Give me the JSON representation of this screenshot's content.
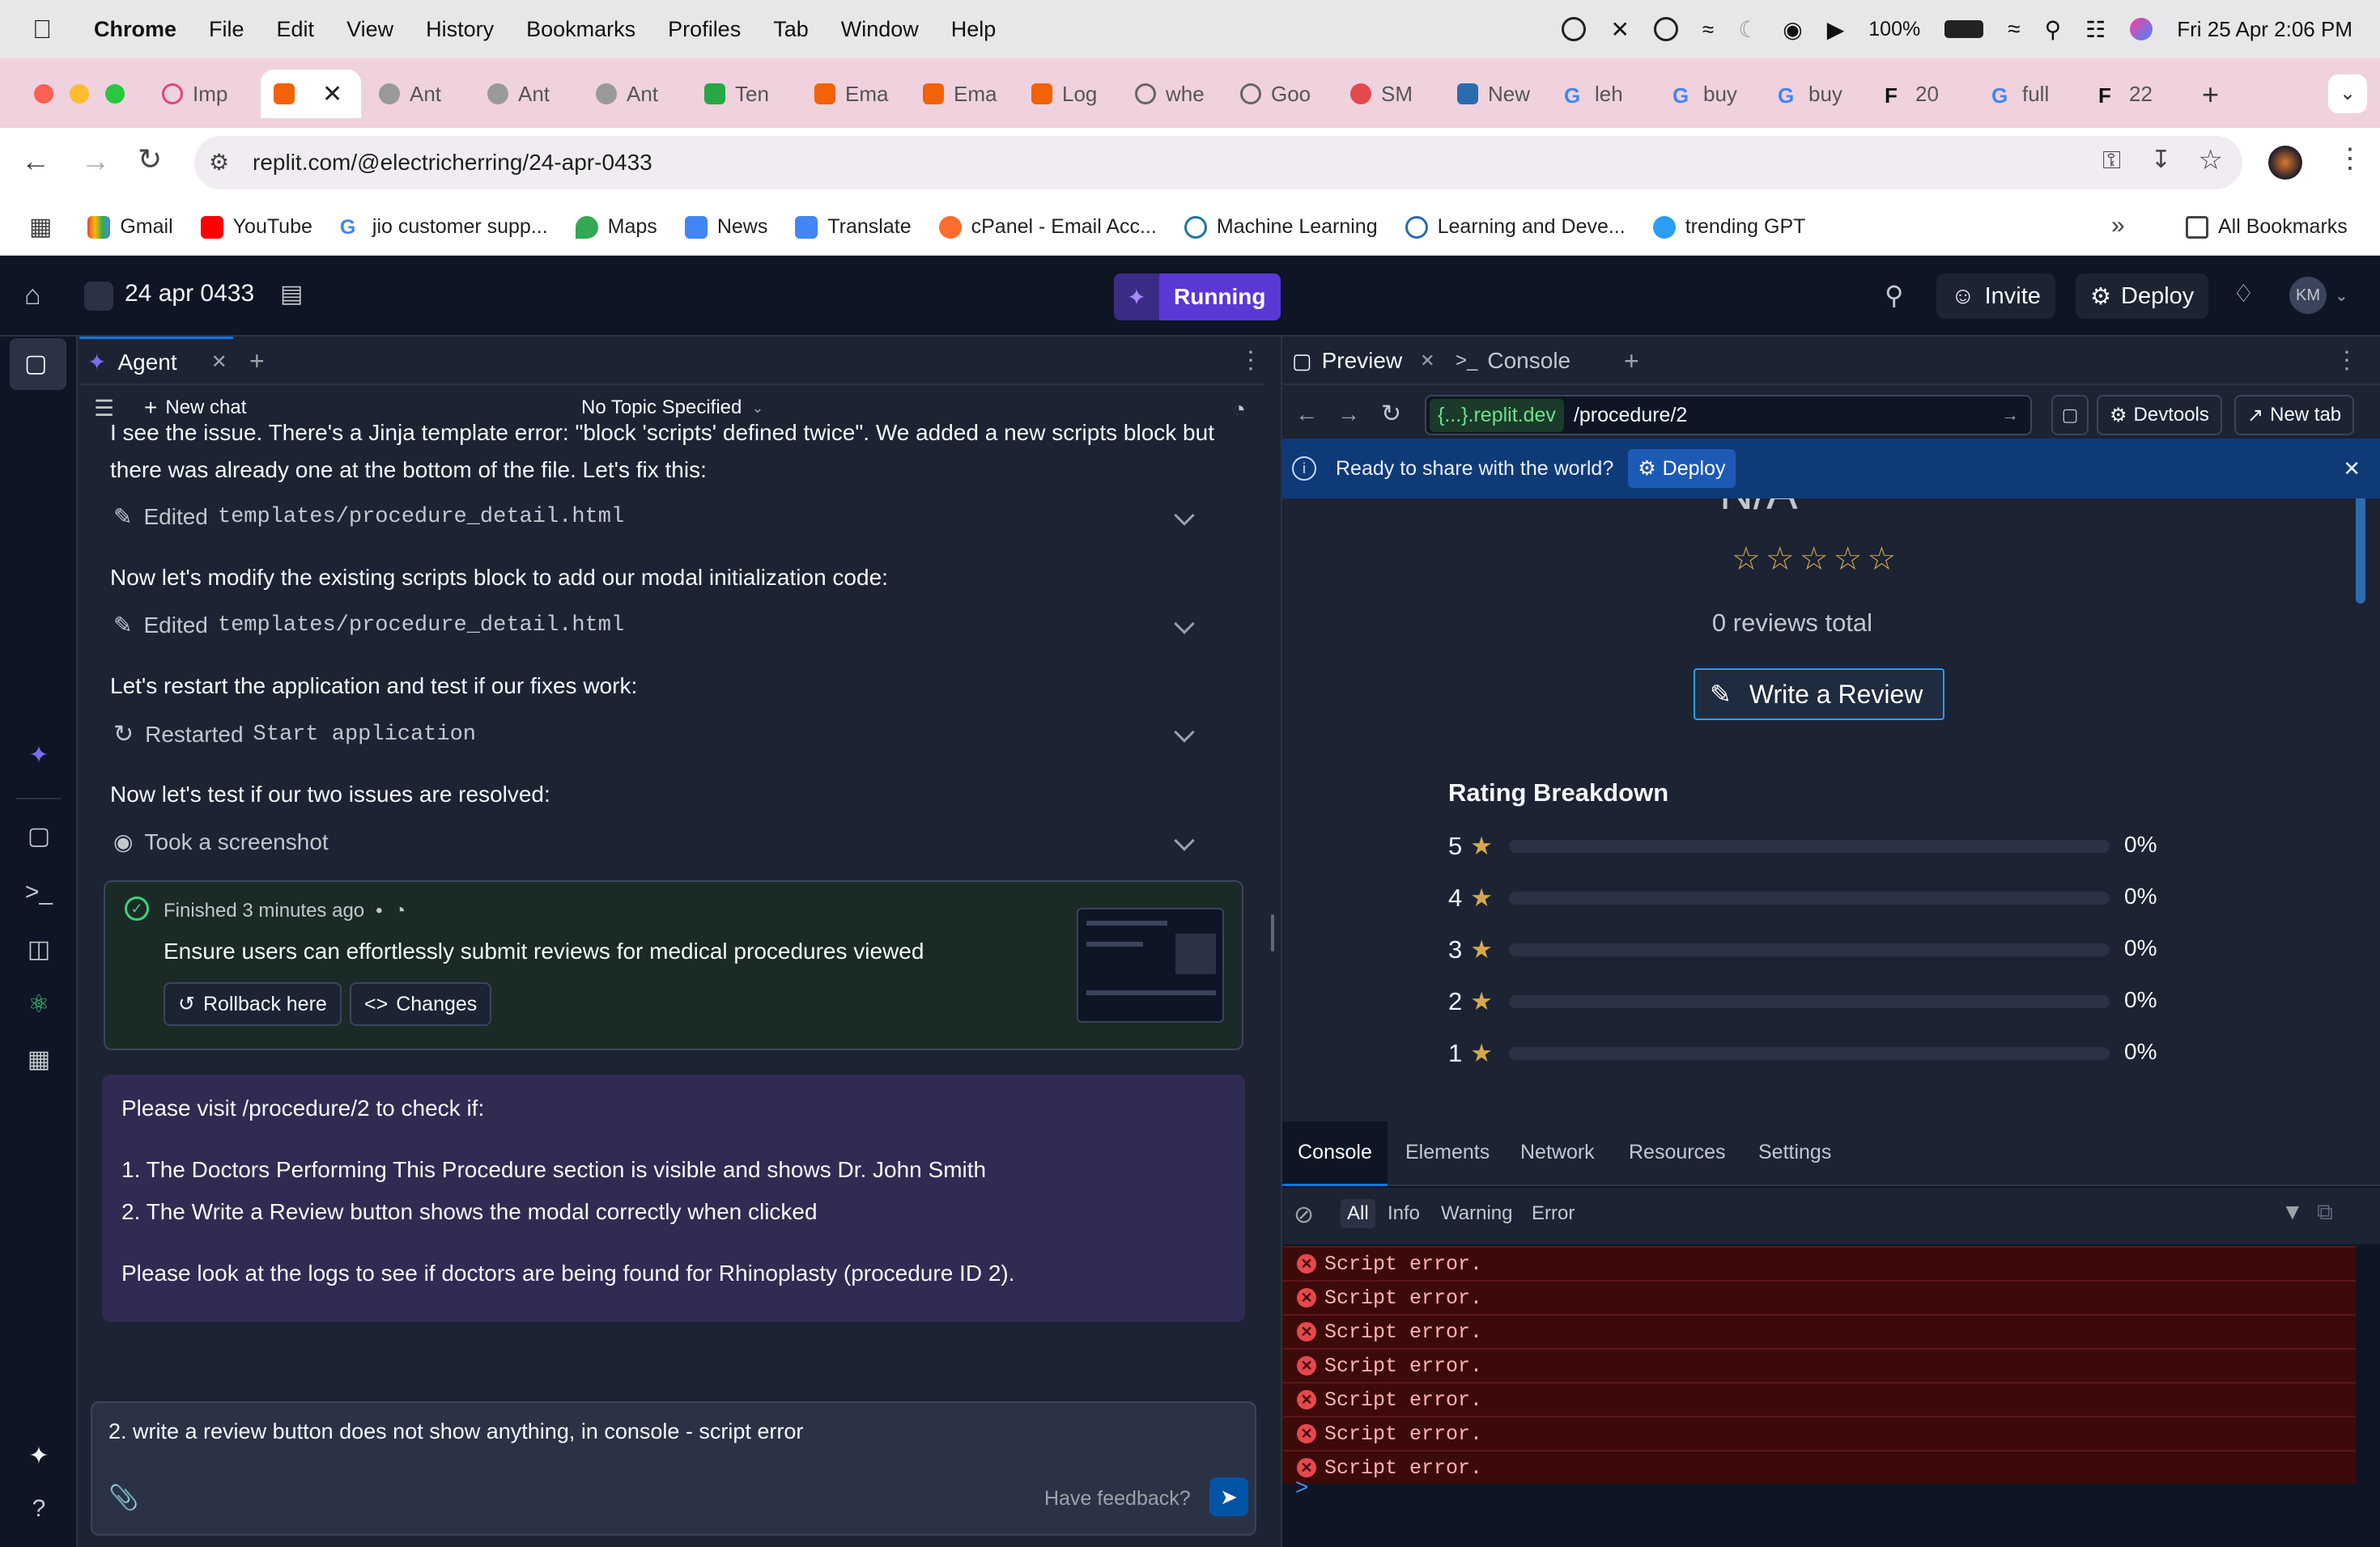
{
  "menubar": {
    "app": "Chrome",
    "items": [
      "File",
      "Edit",
      "View",
      "History",
      "Bookmarks",
      "Profiles",
      "Tab",
      "Window",
      "Help"
    ],
    "battery": "100%",
    "datetime": "Fri 25 Apr  2:06 PM"
  },
  "tabs": [
    {
      "label": "Imp"
    },
    {
      "label": ""
    },
    {
      "label": "Ant"
    },
    {
      "label": "Ant"
    },
    {
      "label": "Ant"
    },
    {
      "label": "Ten"
    },
    {
      "label": "Ema"
    },
    {
      "label": "Ema"
    },
    {
      "label": "Log"
    },
    {
      "label": "whe"
    },
    {
      "label": "Goo"
    },
    {
      "label": "SM"
    },
    {
      "label": "New"
    },
    {
      "label": "leh"
    },
    {
      "label": "buy"
    },
    {
      "label": "buy"
    },
    {
      "label": "20"
    },
    {
      "label": "full"
    },
    {
      "label": "22"
    }
  ],
  "address": {
    "url": "replit.com/@electricherring/24-apr-0433"
  },
  "bookmarks": [
    "Gmail",
    "YouTube",
    "jio customer supp...",
    "Maps",
    "News",
    "Translate",
    "cPanel - Email Acc...",
    "Machine Learning",
    "Learning and Deve...",
    "trending GPT"
  ],
  "bookmarks_all": "All Bookmarks",
  "replit": {
    "project": "24 apr 0433",
    "running": "Running",
    "invite": "Invite",
    "deploy": "Deploy",
    "avatar": "KM"
  },
  "agent": {
    "tab": "Agent",
    "new_chat": "New chat",
    "topic": "No Topic Specified",
    "msg1_line1": "I see the issue. There's a Jinja template error: \"block 'scripts' defined twice\". We added a new scripts block but",
    "msg1_line2": "there was already one at the bottom of the file. Let's fix this:",
    "action1_prefix": "Edited",
    "action1_file": "templates/procedure_detail.html",
    "msg2": "Now let's modify the existing scripts block to add our modal initialization code:",
    "action2_prefix": "Edited",
    "action2_file": "templates/procedure_detail.html",
    "msg3": "Let's restart the application and test if our fixes work:",
    "action3_prefix": "Restarted",
    "action3_file": "Start application",
    "msg4": "Now let's test if our two issues are resolved:",
    "action4": "Took a screenshot",
    "finished": "Finished 3 minutes ago",
    "checkpoint_title": "Ensure users can effortlessly submit reviews for medical procedures viewed",
    "rollback": "Rollback here",
    "changes": "Changes",
    "user_msg_intro": "Please visit /procedure/2 to check if:",
    "user_item1": "1. The Doctors Performing This Procedure section is visible and shows Dr. John Smith",
    "user_item2": "2. The Write a Review button shows the modal correctly when clicked",
    "user_msg_outro": "Please look at the logs to see if doctors are being found for Rhinoplasty (procedure ID 2).",
    "input_value": "2. write a review button does not show anything, in console - script error",
    "feedback": "Have feedback?"
  },
  "preview": {
    "tab_preview": "Preview",
    "tab_console": "Console",
    "domain": "{...}.replit.dev",
    "path": "/procedure/2",
    "devtools": "Devtools",
    "new_tab": "New tab",
    "banner_text": "Ready to share with the world?",
    "banner_deploy": "Deploy",
    "rating_partial": "N/A",
    "reviews_total": "0 reviews total",
    "write_review": "Write a Review",
    "breakdown_title": "Rating Breakdown",
    "breakdown": [
      {
        "stars": "5",
        "pct": "0%",
        "fraction": 0
      },
      {
        "stars": "4",
        "pct": "0%",
        "fraction": 0
      },
      {
        "stars": "3",
        "pct": "0%",
        "fraction": 0
      },
      {
        "stars": "2",
        "pct": "0%",
        "fraction": 0
      },
      {
        "stars": "1",
        "pct": "0%",
        "fraction": 0
      }
    ]
  },
  "console": {
    "tabs": [
      "Console",
      "Elements",
      "Network",
      "Resources",
      "Settings"
    ],
    "filters": [
      "All",
      "Info",
      "Warning",
      "Error"
    ],
    "errors": [
      "Script error.",
      "Script error.",
      "Script error.",
      "Script error.",
      "Script error.",
      "Script error.",
      "Script error."
    ],
    "prompt": ">"
  }
}
